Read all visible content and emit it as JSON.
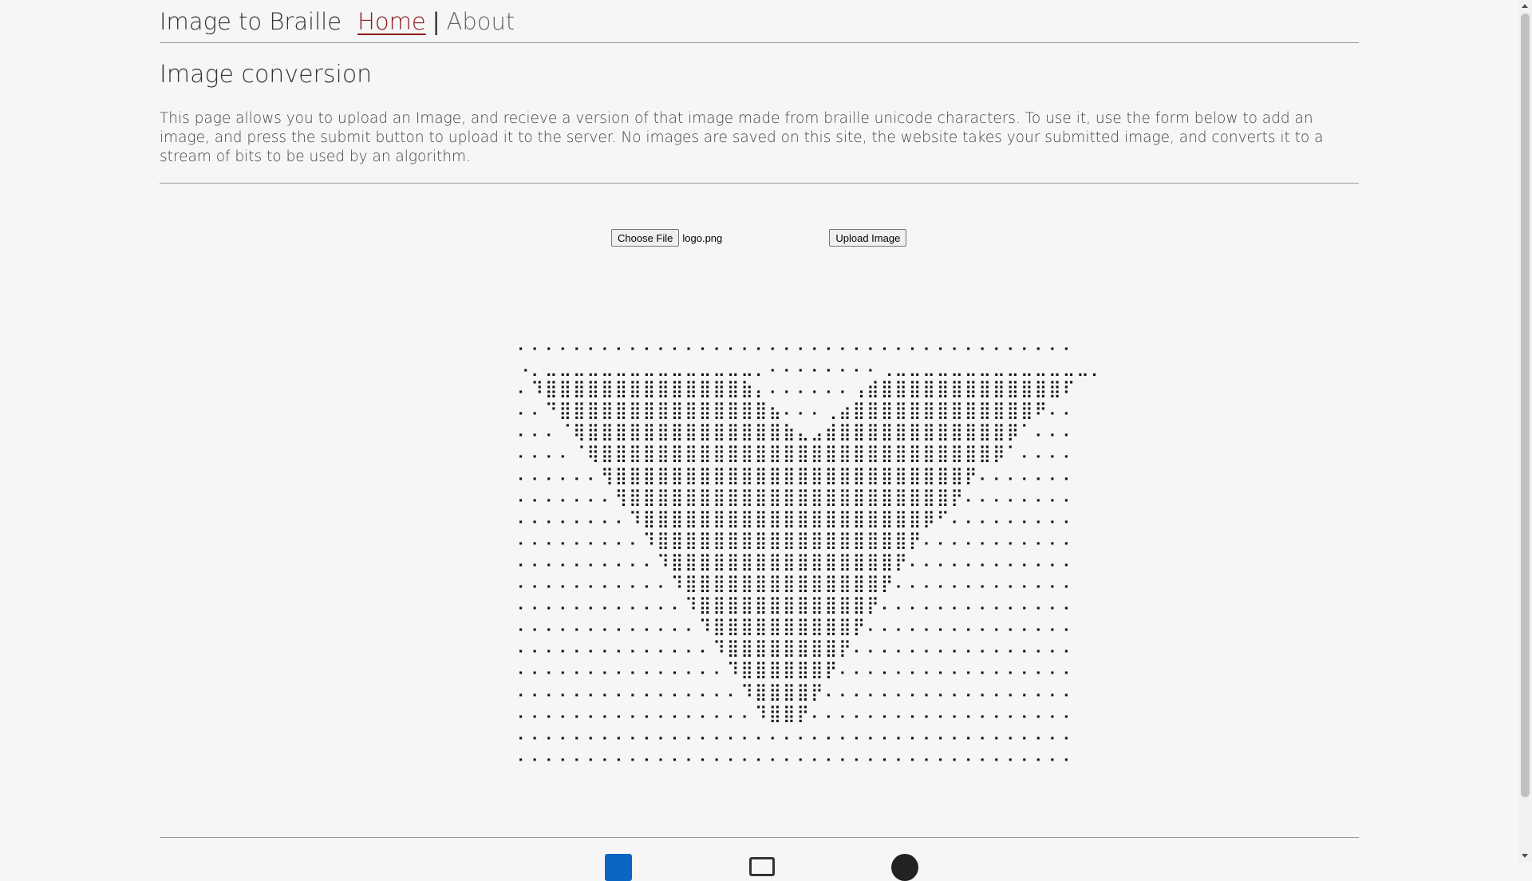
{
  "header": {
    "brand": "Image to Braille",
    "nav": {
      "home": "Home",
      "separator": "|",
      "about": "About"
    }
  },
  "main": {
    "title": "Image conversion",
    "description": "This page allows you to upload an Image, and recieve a version of that image made from braille unicode characters. To use it, use the form below to add an image, and press the submit button to upload it to the server. No images are saved on this site, the website takes your submitted image, and converts it to a stream of bits to be used by an algorithm."
  },
  "form": {
    "choose_file_label": "Choose File",
    "file_name": "logo.png",
    "upload_label": "Upload Image"
  },
  "braille_output": "⠄⠄⠄⠄⠄⠄⠄⠄⠄⠄⠄⠄⠄⠄⠄⠄⠄⠄⠄⠄⠄⠄⠄⠄⠄⠄⠄⠄⠄⠄⠄⠄⠄⠄⠄⠄⠄⠄⠄⠄\n⠠⡀⣀⣀⣀⣀⣀⣀⣀⣀⣀⣀⣀⣀⣀⣀⣀⡀⠄⠄⠄⠄⠄⠄⠄⠄⢀⣀⣀⣀⣀⣀⣀⣀⣀⣀⣀⣀⣀⣀⣀⡀\n⠄⠹⣿⣿⣿⣿⣿⣿⣿⣿⣿⣿⣿⣿⣿⣿⣷⡄⠄⠄⠄⠄⠄⠄⢠⣾⣿⣿⣿⣿⣿⣿⣿⣿⣿⣿⣿⣿⣿⠏\n⠄⠄⠙⣿⣿⣿⣿⣿⣿⣿⣿⣿⣿⣿⣿⣿⣿⣿⣦⠄⠄⠄⢀⣴⣿⣿⣿⣿⣿⣿⣿⣿⣿⣿⣿⣿⣿⠟⠄⠄\n⠄⠄⠄⠈⢿⣿⣿⣿⣿⣿⣿⣿⣿⣿⣿⣿⣿⣿⣿⣷⣄⣠⣾⣿⣿⣿⣿⣿⣿⣿⣿⣿⣿⣿⣿⡿⠁⠄⠄⠄\n⠄⠄⠄⠄⠈⢿⣿⣿⣿⣿⣿⣿⣿⣿⣿⣿⣿⣿⣿⣿⣿⣿⣿⣿⣿⣿⣿⣿⣿⣿⣿⣿⣿⣿⡿⠁⠄⠄⠄⠄\n⠄⠄⠄⠄⠄⠄⢻⣿⣿⣿⣿⣿⣿⣿⣿⣿⣿⣿⣿⣿⣿⣿⣿⣿⣿⣿⣿⣿⣿⣿⣿⣿⡟⠄⠄⠄⠄⠄⠄⠄\n⠄⠄⠄⠄⠄⠄⠄⢻⣿⣿⣿⣿⣿⣿⣿⣿⣿⣿⣿⣿⣿⣿⣿⣿⣿⣿⣿⣿⣿⣿⣿⡟⠄⠄⠄⠄⠄⠄⠄⠄\n⠄⠄⠄⠄⠄⠄⠄⠄⠹⣿⣿⣿⣿⣿⣿⣿⣿⣿⣿⣿⣿⣿⣿⣿⣿⣿⣿⣿⣿⡿⠋⠄⠄⠄⠄⠄⠄⠄⠄⠄\n⠄⠄⠄⠄⠄⠄⠄⠄⠄⠹⣿⣿⣿⣿⣿⣿⣿⣿⣿⣿⣿⣿⣿⣿⣿⣿⣿⣿⡟⠄⠄⠄⠄⠄⠄⠄⠄⠄⠄⠄\n⠄⠄⠄⠄⠄⠄⠄⠄⠄⠄⠹⣿⣿⣿⣿⣿⣿⣿⣿⣿⣿⣿⣿⣿⣿⣿⣿⡟⠄⠄⠄⠄⠄⠄⠄⠄⠄⠄⠄⠄\n⠄⠄⠄⠄⠄⠄⠄⠄⠄⠄⠄⠹⣿⣿⣿⣿⣿⣿⣿⣿⣿⣿⣿⣿⣿⣿⡟⠄⠄⠄⠄⠄⠄⠄⠄⠄⠄⠄⠄⠄\n⠄⠄⠄⠄⠄⠄⠄⠄⠄⠄⠄⠄⠹⣿⣿⣿⣿⣿⣿⣿⣿⣿⣿⣿⣿⡟⠄⠄⠄⠄⠄⠄⠄⠄⠄⠄⠄⠄⠄⠄\n⠄⠄⠄⠄⠄⠄⠄⠄⠄⠄⠄⠄⠄⠹⣿⣿⣿⣿⣿⣿⣿⣿⣿⣿⡟⠄⠄⠄⠄⠄⠄⠄⠄⠄⠄⠄⠄⠄⠄⠄\n⠄⠄⠄⠄⠄⠄⠄⠄⠄⠄⠄⠄⠄⠄⠹⣿⣿⣿⣿⣿⣿⣿⣿⡟⠄⠄⠄⠄⠄⠄⠄⠄⠄⠄⠄⠄⠄⠄⠄⠄\n⠄⠄⠄⠄⠄⠄⠄⠄⠄⠄⠄⠄⠄⠄⠄⠹⣿⣿⣿⣿⣿⣿⡟⠄⠄⠄⠄⠄⠄⠄⠄⠄⠄⠄⠄⠄⠄⠄⠄⠄\n⠄⠄⠄⠄⠄⠄⠄⠄⠄⠄⠄⠄⠄⠄⠄⠄⠹⣿⣿⣿⣿⡟⠄⠄⠄⠄⠄⠄⠄⠄⠄⠄⠄⠄⠄⠄⠄⠄⠄⠄\n⠄⠄⠄⠄⠄⠄⠄⠄⠄⠄⠄⠄⠄⠄⠄⠄⠄⠹⣿⣿⡟⠄⠄⠄⠄⠄⠄⠄⠄⠄⠄⠄⠄⠄⠄⠄⠄⠄⠄⠄\n⠄⠄⠄⠄⠄⠄⠄⠄⠄⠄⠄⠄⠄⠄⠄⠄⠄⠄⠄⠄⠄⠄⠄⠄⠄⠄⠄⠄⠄⠄⠄⠄⠄⠄⠄⠄⠄⠄⠄⠄\n⠄⠄⠄⠄⠄⠄⠄⠄⠄⠄⠄⠄⠄⠄⠄⠄⠄⠄⠄⠄⠄⠄⠄⠄⠄⠄⠄⠄⠄⠄⠄⠄⠄⠄⠄⠄⠄⠄⠄⠄",
  "footer": {
    "icons": [
      "linkedin-icon",
      "mail-icon",
      "github-icon"
    ],
    "colors": {
      "linkedin": "#0a66c2",
      "active_link": "#8b1a1a"
    }
  }
}
